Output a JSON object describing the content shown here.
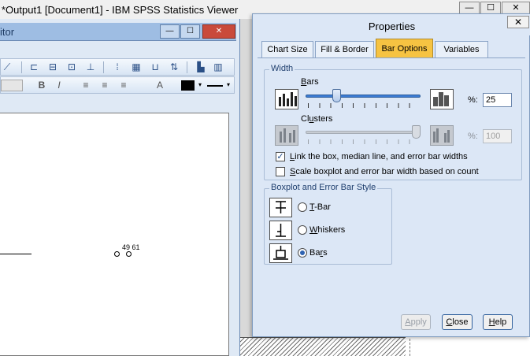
{
  "viewer": {
    "title": "*Output1 [Document1] - IBM SPSS Statistics Viewer",
    "min_glyph": "—",
    "max_glyph": "☐",
    "close_glyph": "✕"
  },
  "editor": {
    "title": "itor",
    "min_glyph": "—",
    "max_glyph": "☐",
    "close_glyph": "✕",
    "toolbar2": {
      "bold": "B",
      "italic": "I",
      "text_style": "A"
    },
    "chart": {
      "outlier_label": "49 61"
    }
  },
  "properties": {
    "title": "Properties",
    "close_glyph": "✕",
    "tabs": [
      {
        "label": "Chart Size",
        "active": false
      },
      {
        "label": "Fill & Border",
        "active": false
      },
      {
        "label": "Bar Options",
        "active": true
      },
      {
        "label": "Variables",
        "active": false
      }
    ],
    "width": {
      "legend": "Width",
      "bars": {
        "label_pre": "",
        "label_ul": "B",
        "label_post": "ars",
        "pct_label": "%:",
        "value": "25",
        "slider_fraction": 0.25,
        "enabled": true
      },
      "clusters": {
        "label_pre": "Cl",
        "label_ul": "u",
        "label_post": "sters",
        "pct_label": "%:",
        "value": "100",
        "slider_fraction": 1.0,
        "enabled": false
      },
      "link_checkbox": {
        "checked": true,
        "check_glyph": "✓",
        "label_ul": "L",
        "label_post": "ink the box, median line, and error bar widths"
      },
      "scale_checkbox": {
        "checked": false,
        "check_glyph": "",
        "label_ul": "S",
        "label_post": "cale boxplot and error bar width based on count"
      }
    },
    "boxplot_style": {
      "legend": "Boxplot and Error Bar Style",
      "options": [
        {
          "label_ul": "T",
          "label_post": "-Bar",
          "selected": false
        },
        {
          "label_ul": "W",
          "label_post": "hiskers",
          "selected": false
        },
        {
          "label_pre": "Ba",
          "label_ul": "r",
          "label_post": "s",
          "selected": true
        }
      ]
    },
    "buttons": {
      "apply": {
        "label_ul": "A",
        "label_post": "pply",
        "enabled": false
      },
      "close": {
        "label_ul": "C",
        "label_post": "lose",
        "enabled": true
      },
      "help": {
        "label_ul": "H",
        "label_post": "elp",
        "enabled": true
      }
    }
  }
}
